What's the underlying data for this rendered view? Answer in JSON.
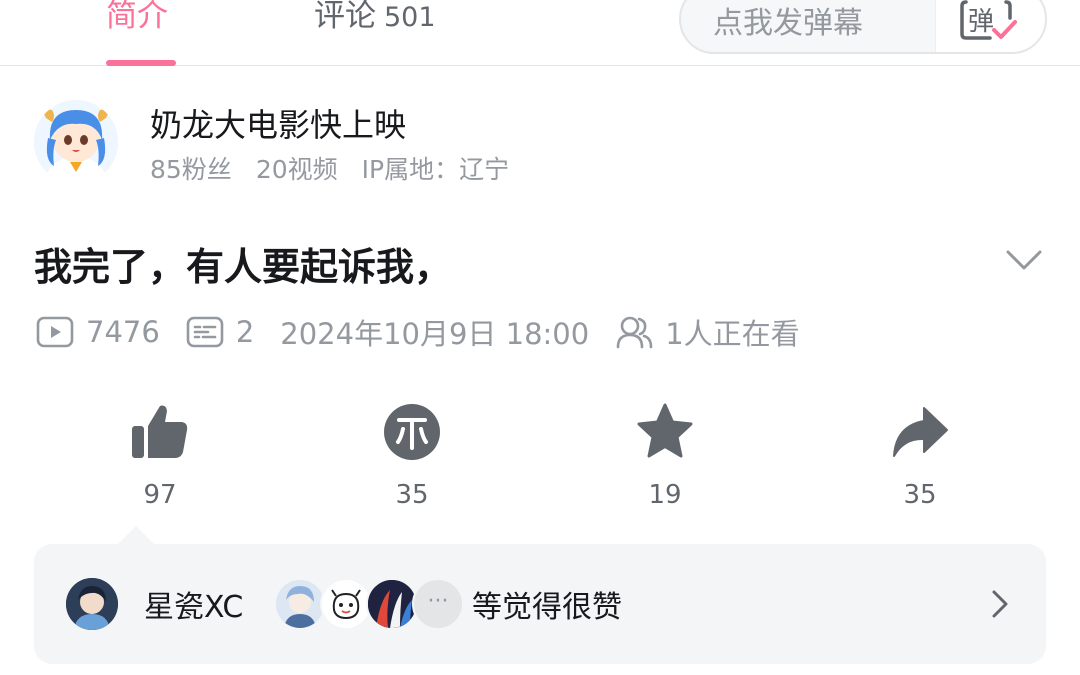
{
  "tabs": {
    "intro_label": "简介",
    "comments_label": "评论",
    "comments_count": "501"
  },
  "danmaku": {
    "placeholder": "点我发弹幕",
    "toggle_label": "弹"
  },
  "uploader": {
    "name": "奶龙大电影快上映",
    "followers": "85粉丝",
    "videos": "20视频",
    "ip_location": "IP属地：辽宁"
  },
  "video": {
    "title": "我完了，有人要起诉我，",
    "views": "7476",
    "danmaku_count": "2",
    "publish_time": "2024年10月9日 18:00",
    "watching_now": "1人正在看"
  },
  "actions": {
    "like_count": "97",
    "coin_count": "35",
    "favorite_count": "19",
    "share_count": "35"
  },
  "likers": {
    "first_name": "星瓷XC",
    "more_label": "···",
    "suffix": "等觉得很赞"
  },
  "colors": {
    "accent": "#fb7299",
    "text_primary": "#18191c",
    "text_secondary": "#9499a0",
    "icon_gray": "#61666d",
    "card_bg": "#f4f5f7"
  }
}
